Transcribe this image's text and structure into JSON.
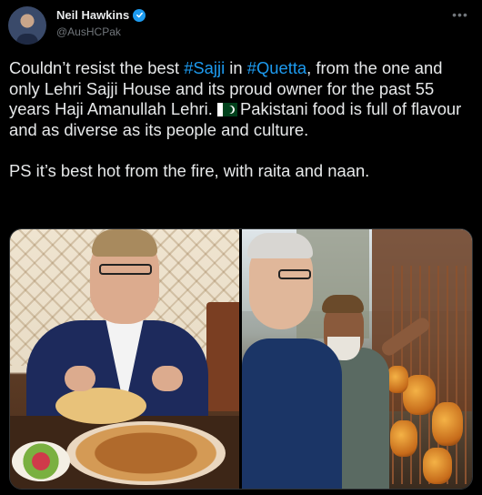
{
  "author": {
    "name": "Neil Hawkins",
    "handle": "@AusHCPak",
    "verified": true
  },
  "tweet": {
    "line1_pre": "Couldn’t resist the best ",
    "hashtag1": "#Sajji",
    "line1_mid": " in ",
    "hashtag2": "#Quetta",
    "line1_post": ", from the one and only Lehri Sajji House and its proud owner for the past 55 years Haji Amanullah Lehri. ",
    "flag_icon": "pakistan-flag",
    "line1_end": "Pakistani food is full of flavour and as diverse as its people and culture.",
    "line2": "PS it’s best hot from the fire, with raita and naan."
  },
  "media": {
    "count": 2
  },
  "colors": {
    "background": "#000000",
    "text": "#e7e9ea",
    "secondary": "#71767b",
    "accent": "#1d9bf0"
  }
}
